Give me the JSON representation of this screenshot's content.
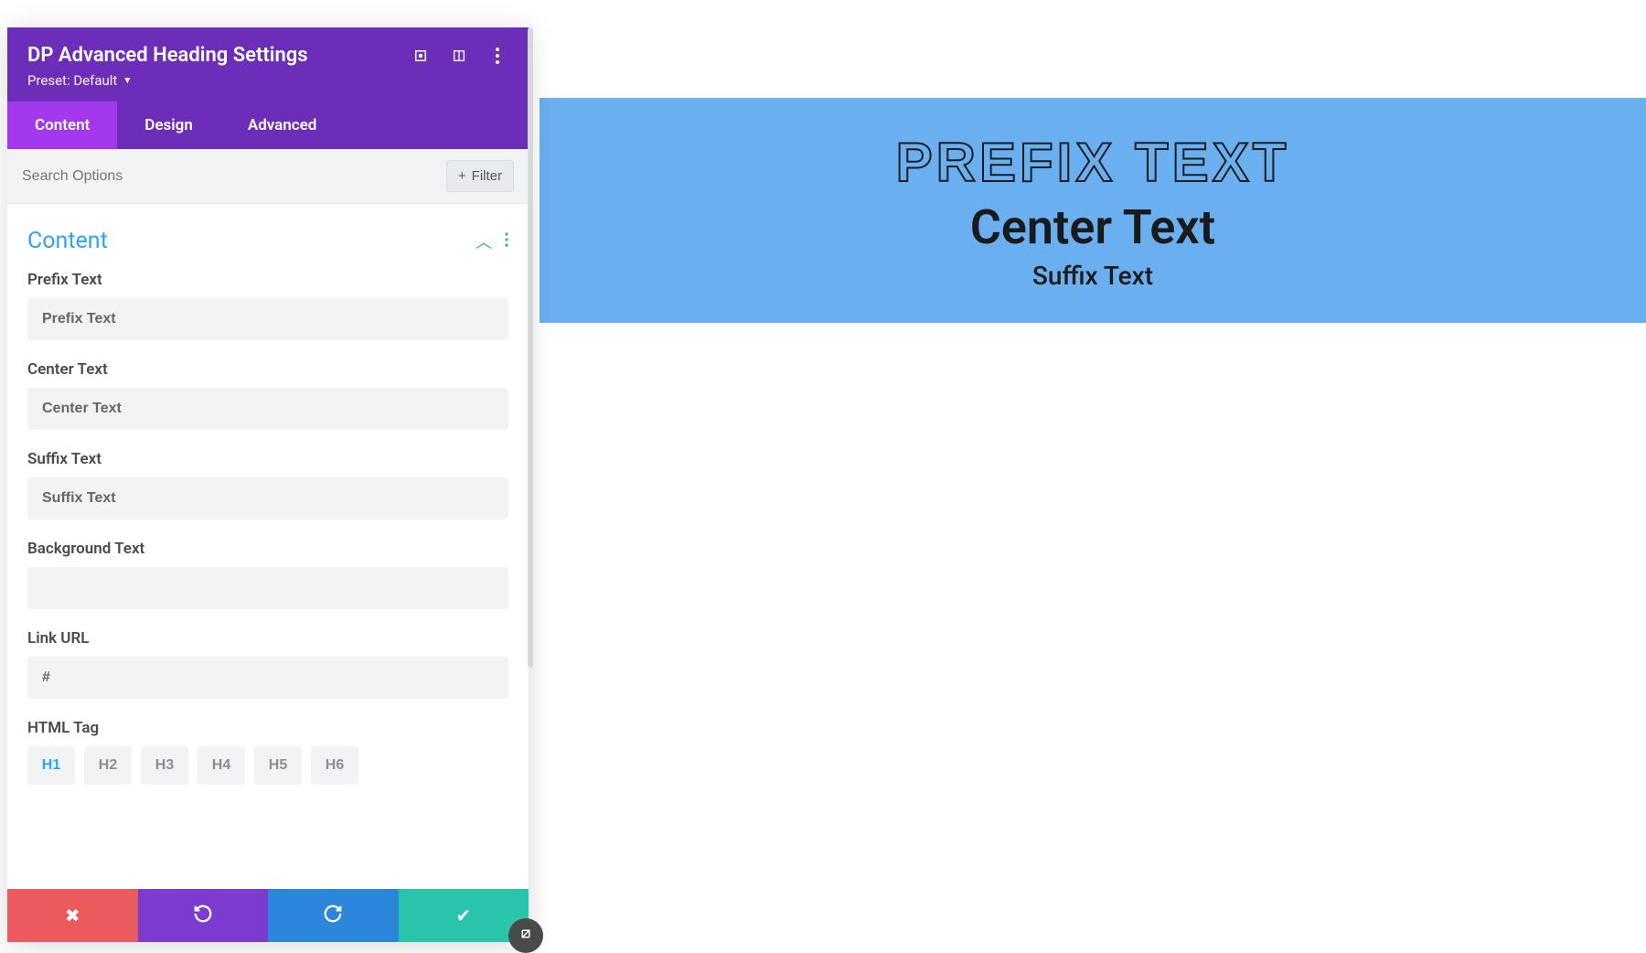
{
  "header": {
    "title": "DP Advanced Heading Settings",
    "preset_label": "Preset: Default"
  },
  "tabs": {
    "content": "Content",
    "design": "Design",
    "advanced": "Advanced"
  },
  "search": {
    "placeholder": "Search Options",
    "filter_label": "Filter"
  },
  "section": {
    "title": "Content"
  },
  "fields": {
    "prefix": {
      "label": "Prefix Text",
      "value": "Prefix Text"
    },
    "center": {
      "label": "Center Text",
      "value": "Center Text"
    },
    "suffix": {
      "label": "Suffix Text",
      "value": "Suffix Text"
    },
    "background": {
      "label": "Background Text",
      "value": ""
    },
    "link": {
      "label": "Link URL",
      "value": "#"
    },
    "htmltag": {
      "label": "HTML Tag"
    }
  },
  "html_tags": {
    "h1": "H1",
    "h2": "H2",
    "h3": "H3",
    "h4": "H4",
    "h5": "H5",
    "h6": "H6",
    "active": "H1"
  },
  "preview": {
    "prefix": "PREFIX TEXT",
    "center": "Center Text",
    "suffix": "Suffix Text"
  },
  "colors": {
    "accent": "#2ea3f2",
    "header": "#6c2eb9",
    "tabActive": "#a338ef",
    "previewBg": "#6aaff0"
  }
}
